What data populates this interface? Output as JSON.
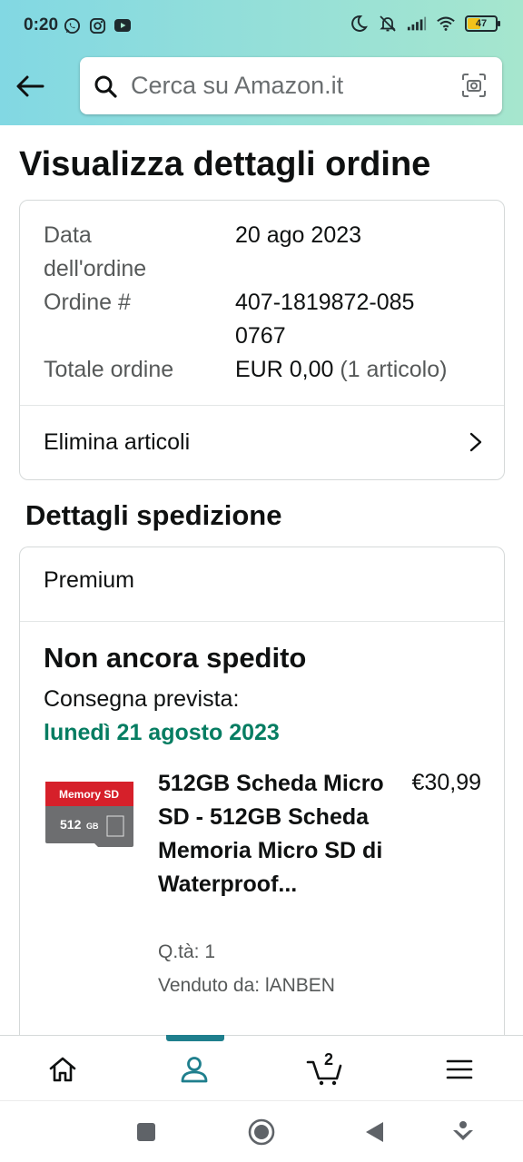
{
  "status_bar": {
    "time": "0:20",
    "battery": "47",
    "battery_level": 0.47
  },
  "search": {
    "placeholder": "Cerca su Amazon.it"
  },
  "page": {
    "title": "Visualizza dettagli ordine"
  },
  "order": {
    "date_label": "Data dell'ordine",
    "date_value": "20 ago 2023",
    "number_label": "Ordine #",
    "number_value": "407-1819872-0850767",
    "total_label": "Totale ordine",
    "total_value": "EUR 0,00",
    "total_items": "(1 articolo)",
    "delete_items": "Elimina articoli"
  },
  "shipment": {
    "section_title": "Dettagli spedizione",
    "service": "Premium",
    "status": "Non ancora spedito",
    "delivery_label": "Consegna prevista:",
    "delivery_date": "lunedì 21 agosto 2023",
    "delivery_color": "#067d62"
  },
  "product": {
    "title": "512GB Scheda Micro SD - 512GB Scheda Memoria Micro SD di Waterproof...",
    "price": "€30,99",
    "qty": "Q.tà: 1",
    "seller": "Venduto da: lANBEN",
    "image_text_top": "Memory SD",
    "image_capacity": "512",
    "image_unit": "GB"
  },
  "bottom_nav": {
    "active": "account",
    "accent": "#1f7f8d",
    "cart_count": "2"
  }
}
